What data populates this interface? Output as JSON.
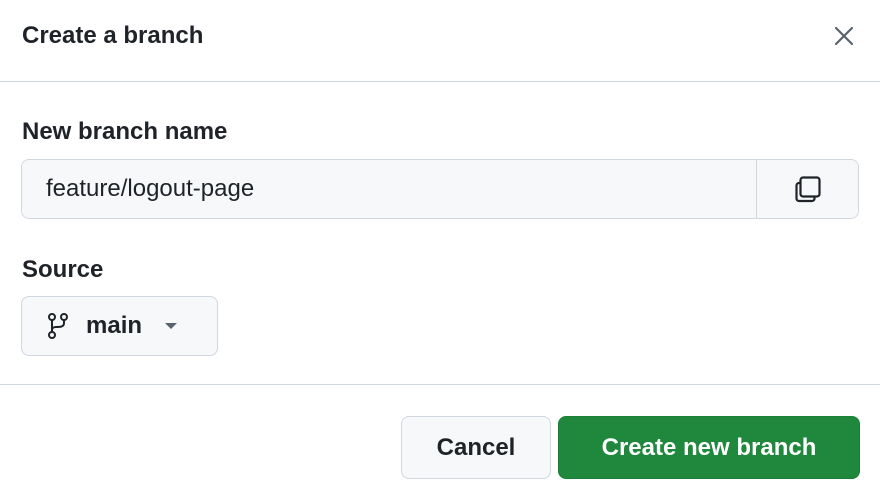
{
  "dialog": {
    "title": "Create a branch",
    "close_icon": "close-icon"
  },
  "form": {
    "name_label": "New branch name",
    "name_value": "feature/logout-page",
    "copy_icon": "copy-icon",
    "source_label": "Source",
    "source_value": "main",
    "source_icon": "git-branch-icon",
    "source_caret_icon": "caret-down-icon"
  },
  "footer": {
    "cancel_label": "Cancel",
    "create_label": "Create new branch"
  },
  "colors": {
    "primary_button": "#1f883d",
    "border": "#d0d7de",
    "field_bg": "#f6f8fa"
  }
}
